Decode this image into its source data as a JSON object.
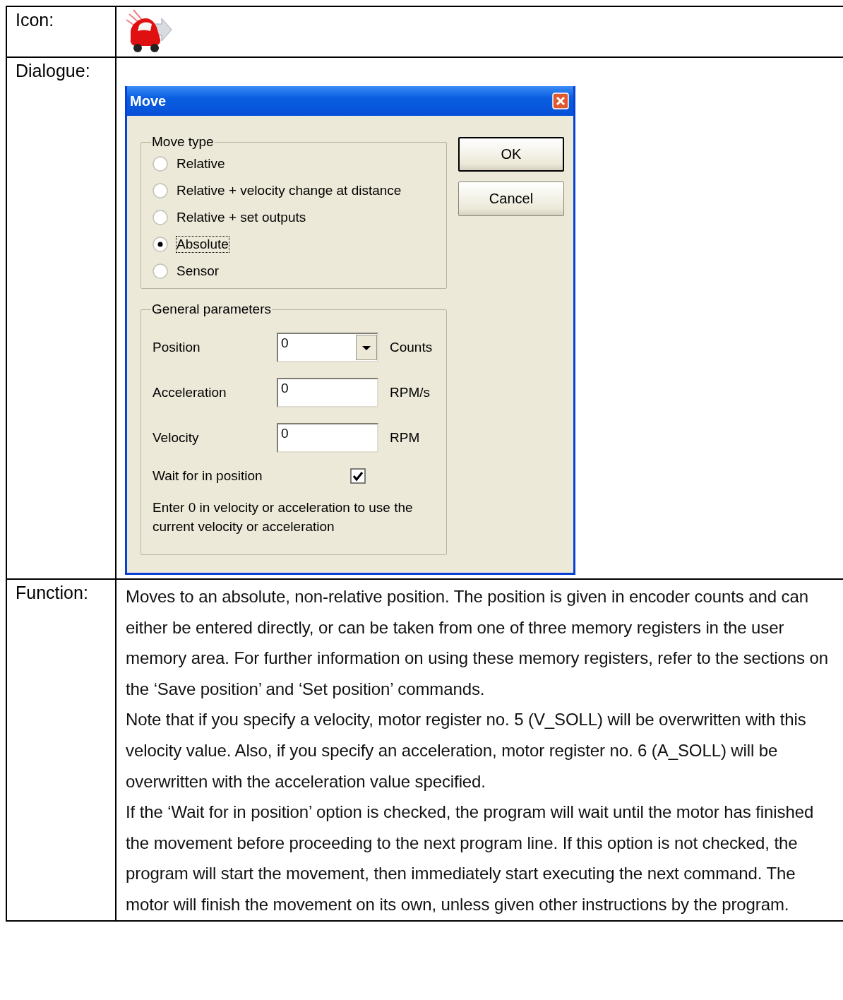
{
  "rows": [
    {
      "label": "Icon:",
      "kind": "icon"
    },
    {
      "label": "Dialogue:",
      "kind": "dialog",
      "dialog": {
        "title": "Move",
        "move_type": {
          "title": "Move type",
          "options": [
            {
              "label": "Relative",
              "selected": false
            },
            {
              "label": "Relative + velocity change at distance",
              "selected": false
            },
            {
              "label": "Relative + set outputs",
              "selected": false
            },
            {
              "label": "Absolute",
              "selected": true
            },
            {
              "label": "Sensor",
              "selected": false
            }
          ]
        },
        "buttons": [
          {
            "label": "OK",
            "default": true
          },
          {
            "label": "Cancel",
            "default": false
          }
        ],
        "general": {
          "title": "General parameters",
          "fields": [
            {
              "label": "Position",
              "value": "0",
              "unit": "Counts",
              "kind": "dropdown"
            },
            {
              "label": "Acceleration",
              "value": "0",
              "unit": "RPM/s",
              "kind": "text"
            },
            {
              "label": "Velocity",
              "value": "0",
              "unit": "RPM",
              "kind": "text"
            }
          ],
          "checkbox": {
            "label": "Wait for in position",
            "checked": true
          },
          "note": "Enter 0 in velocity or acceleration to use the current velocity or acceleration"
        }
      }
    },
    {
      "label": "Function:",
      "kind": "text",
      "paragraphs": [
        "Moves to an absolute, non-relative position. The position is given in encoder counts and can either be entered directly, or can be taken from one of three memory registers in the user memory area. For further information on using these memory registers, refer to the sections on the ‘Save position’ and ‘Set position’ commands.",
        "Note that if you specify a velocity, motor register no. 5 (V_SOLL) will be overwritten with this velocity value. Also, if you specify an acceleration, motor register no. 6 (A_SOLL) will be overwritten with the acceleration value specified.",
        "If the ‘Wait for in position’ option is checked, the program will wait until the motor has finished the movement before proceeding to the next program line. If this option is not checked, the program will start the movement, then immediately start executing the next command. The motor will finish the movement on its own, unless given other instructions by the program."
      ]
    }
  ]
}
